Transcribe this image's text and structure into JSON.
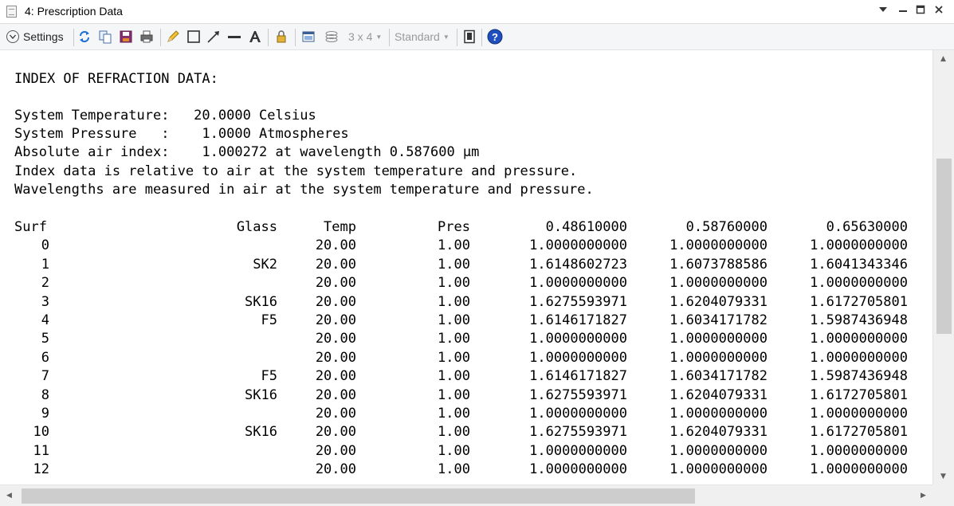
{
  "window": {
    "title": "4: Prescription Data",
    "icons": [
      "document-icon",
      "dropdown-chevron-icon",
      "minimize-icon",
      "maximize-icon",
      "close-icon"
    ]
  },
  "toolbar": {
    "settings_label": "Settings",
    "layout_label": "3 x 4",
    "style_label": "Standard",
    "icons": [
      "refresh-icon",
      "copy-icon",
      "save-icon",
      "print-icon",
      "pencil-icon",
      "rectangle-icon",
      "line-arrow-icon",
      "line-icon",
      "text-icon",
      "lock-icon",
      "window-icon",
      "layers-icon",
      "device-icon",
      "help-icon"
    ]
  },
  "report": {
    "heading": "INDEX OF REFRACTION DATA:",
    "lines": [
      "System Temperature:   20.0000 Celsius",
      "System Pressure   :    1.0000 Atmospheres",
      "Absolute air index:    1.000272 at wavelength 0.587600 µm",
      "Index data is relative to air at the system temperature and pressure.",
      "Wavelengths are measured in air at the system temperature and pressure."
    ],
    "table": {
      "headers": [
        "Surf",
        "Glass",
        "Temp",
        "Pres",
        "0.48610000",
        "0.58760000",
        "0.65630000"
      ],
      "rows": [
        [
          "0",
          "",
          "20.00",
          "1.00",
          "1.0000000000",
          "1.0000000000",
          "1.0000000000"
        ],
        [
          "1",
          "SK2",
          "20.00",
          "1.00",
          "1.6148602723",
          "1.6073788586",
          "1.6041343346"
        ],
        [
          "2",
          "",
          "20.00",
          "1.00",
          "1.0000000000",
          "1.0000000000",
          "1.0000000000"
        ],
        [
          "3",
          "SK16",
          "20.00",
          "1.00",
          "1.6275593971",
          "1.6204079331",
          "1.6172705801"
        ],
        [
          "4",
          "F5",
          "20.00",
          "1.00",
          "1.6146171827",
          "1.6034171782",
          "1.5987436948"
        ],
        [
          "5",
          "",
          "20.00",
          "1.00",
          "1.0000000000",
          "1.0000000000",
          "1.0000000000"
        ],
        [
          "6",
          "",
          "20.00",
          "1.00",
          "1.0000000000",
          "1.0000000000",
          "1.0000000000"
        ],
        [
          "7",
          "F5",
          "20.00",
          "1.00",
          "1.6146171827",
          "1.6034171782",
          "1.5987436948"
        ],
        [
          "8",
          "SK16",
          "20.00",
          "1.00",
          "1.6275593971",
          "1.6204079331",
          "1.6172705801"
        ],
        [
          "9",
          "",
          "20.00",
          "1.00",
          "1.0000000000",
          "1.0000000000",
          "1.0000000000"
        ],
        [
          "10",
          "SK16",
          "20.00",
          "1.00",
          "1.6275593971",
          "1.6204079331",
          "1.6172705801"
        ],
        [
          "11",
          "",
          "20.00",
          "1.00",
          "1.0000000000",
          "1.0000000000",
          "1.0000000000"
        ],
        [
          "12",
          "",
          "20.00",
          "1.00",
          "1.0000000000",
          "1.0000000000",
          "1.0000000000"
        ]
      ]
    }
  },
  "scrollbars": {
    "vertical_position": 0.25,
    "horizontal_position": 0.0
  },
  "colors": {
    "help_blue": "#1f4fbf",
    "toolbar_bg": "#f5f6f7",
    "scroll_thumb": "#cdcdcd"
  }
}
